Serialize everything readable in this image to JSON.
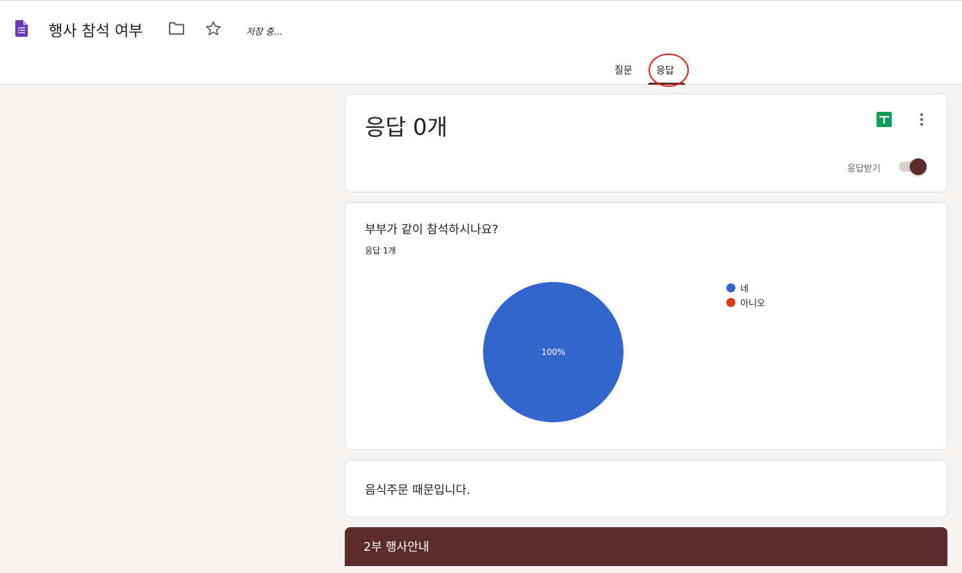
{
  "header": {
    "title": "행사 참석 여부",
    "save_status": "저장 중...",
    "tabs": [
      {
        "label": "질문",
        "active": false
      },
      {
        "label": "응답",
        "active": true
      }
    ]
  },
  "colors": {
    "accent": "#5b2a2a",
    "forms_purple": "#673ab7",
    "sheets_green": "#0f9d58",
    "annotation_red": "#e01b1b"
  },
  "summary": {
    "count_label": "응답 0개",
    "accept_label": "응답받기",
    "accepting": true
  },
  "question": {
    "title": "부부가 같이 참석하시나요?",
    "count_label": "응답 1개"
  },
  "chart_data": {
    "type": "pie",
    "categories": [
      "네",
      "아니오"
    ],
    "values": [
      1,
      0
    ],
    "colors": [
      "#3366cc",
      "#dc3912"
    ],
    "slice_labels": [
      "100%",
      ""
    ],
    "legend_position": "right"
  },
  "note": {
    "text": "음식주문 때문입니다."
  },
  "section": {
    "title": "2부 행사안내"
  }
}
